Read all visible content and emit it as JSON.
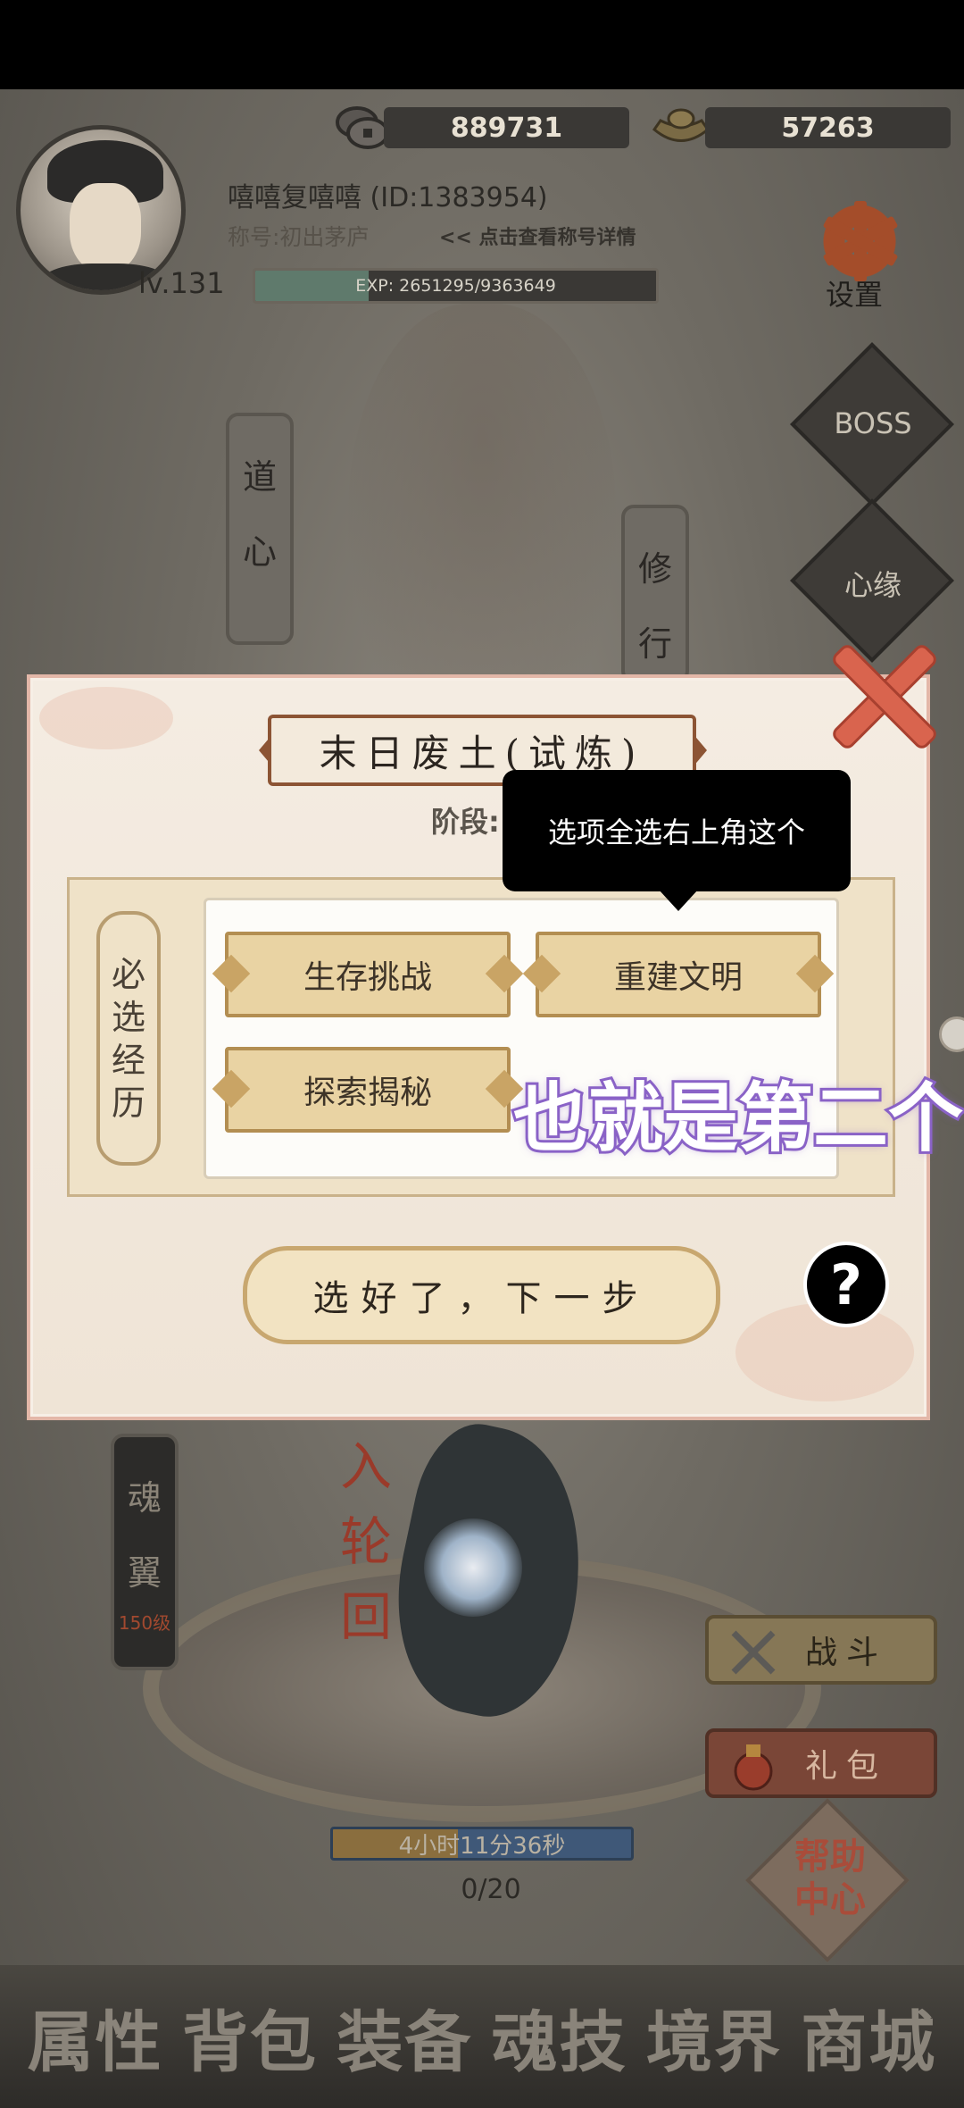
{
  "hud": {
    "silver": "889731",
    "gold": "57263",
    "player_name": "嘻嘻复嘻嘻 (ID:1383954)",
    "player_title": "称号:初出茅庐",
    "title_link": "<< 点击查看称号详情",
    "level": "lv.131",
    "exp_text": "EXP: 2651295/9363649",
    "exp_fraction": 0.283,
    "settings_label": "设置"
  },
  "side_menu": {
    "boss_label": "BOSS",
    "heart_label": "心缘",
    "left_tabs": [
      {
        "chars": [
          "道",
          "心"
        ]
      },
      {
        "chars": [
          "魂",
          "翼"
        ],
        "level": "150级"
      }
    ],
    "right_tab": {
      "chars": [
        "修",
        "行"
      ]
    },
    "battle_label": "战斗",
    "gift_label": "礼包",
    "help_center_label": [
      "帮助",
      "中心"
    ]
  },
  "scene": {
    "reincarnation_chars": [
      "入",
      "轮",
      "回"
    ],
    "timer_text": "4小时11分36秒",
    "timer_fraction": 0.42,
    "progress_count": "0/20"
  },
  "dialog": {
    "title": "末日废土(试炼)",
    "stage_label": "阶段:",
    "tooltip": "选项全选右上角这个",
    "required_label": [
      "必",
      "选",
      "经",
      "历"
    ],
    "options": [
      "生存挑战",
      "重建文明",
      "探索揭秘"
    ],
    "caption": "也就是第二个",
    "next_button": "选好了，下一步",
    "help_symbol": "?"
  },
  "bottom_nav": [
    "属性",
    "背包",
    "装备",
    "魂技",
    "境界",
    "商城"
  ],
  "colors": {
    "dialog_border": "#e3b7a8",
    "option_fill": "#e9d3a3",
    "caption_stroke": "#8a63c7",
    "close_red": "#d9644e"
  }
}
